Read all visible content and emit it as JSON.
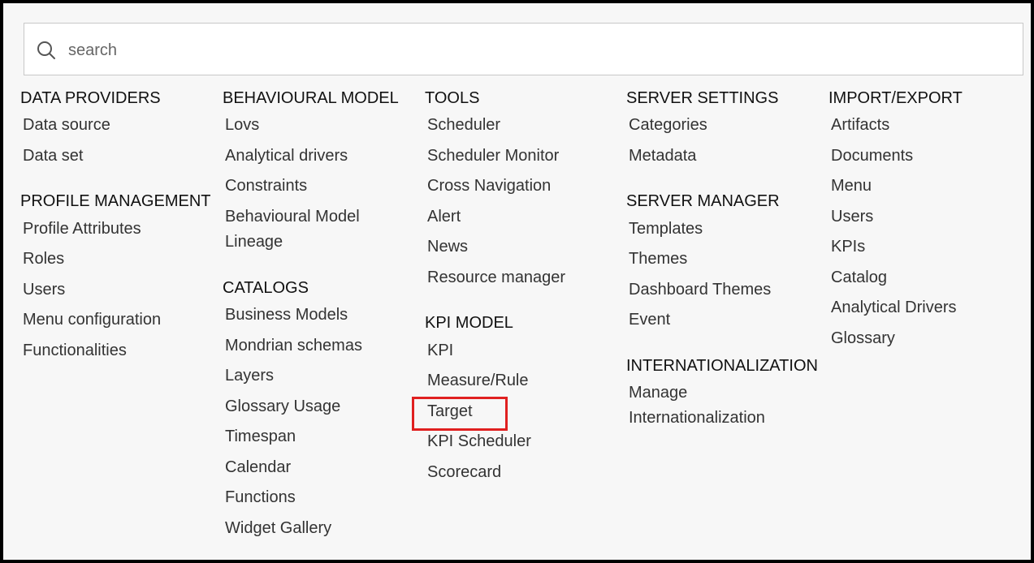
{
  "search": {
    "placeholder": "search",
    "icon": "search-icon"
  },
  "columns": [
    {
      "sections": [
        {
          "heading": "DATA PROVIDERS",
          "items": [
            "Data source",
            "Data set"
          ]
        },
        {
          "heading": "PROFILE MANAGEMENT",
          "items": [
            "Profile Attributes",
            "Roles",
            "Users",
            "Menu configuration",
            "Functionalities"
          ]
        }
      ]
    },
    {
      "sections": [
        {
          "heading": "BEHAVIOURAL MODEL",
          "items": [
            "Lovs",
            "Analytical drivers",
            "Constraints",
            "Behavioural Model Lineage"
          ]
        },
        {
          "heading": "CATALOGS",
          "items": [
            "Business Models",
            "Mondrian schemas",
            "Layers",
            "Glossary Usage",
            "Timespan",
            "Calendar",
            "Functions",
            "Widget Gallery"
          ]
        }
      ]
    },
    {
      "sections": [
        {
          "heading": "TOOLS",
          "items": [
            "Scheduler",
            "Scheduler Monitor",
            "Cross Navigation",
            "Alert",
            "News",
            "Resource manager"
          ]
        },
        {
          "heading": "KPI MODEL",
          "items": [
            "KPI",
            "Measure/Rule",
            "Target",
            "KPI Scheduler",
            "Scorecard"
          ]
        }
      ]
    },
    {
      "sections": [
        {
          "heading": "SERVER SETTINGS",
          "items": [
            "Categories",
            "Metadata"
          ]
        },
        {
          "heading": "SERVER MANAGER",
          "items": [
            "Templates",
            "Themes",
            "Dashboard Themes",
            "Event"
          ]
        },
        {
          "heading": "INTERNATIONALIZATION",
          "items": [
            "Manage Internationalization"
          ]
        }
      ]
    },
    {
      "sections": [
        {
          "heading": "IMPORT/EXPORT",
          "items": [
            "Artifacts",
            "Documents",
            "Menu",
            "Users",
            "KPIs",
            "Catalog",
            "Analytical Drivers",
            "Glossary"
          ]
        }
      ]
    }
  ],
  "highlighted_item": "Target",
  "colors": {
    "highlight_border": "#e02020",
    "frame_border": "#000000",
    "background": "#f7f7f7"
  }
}
